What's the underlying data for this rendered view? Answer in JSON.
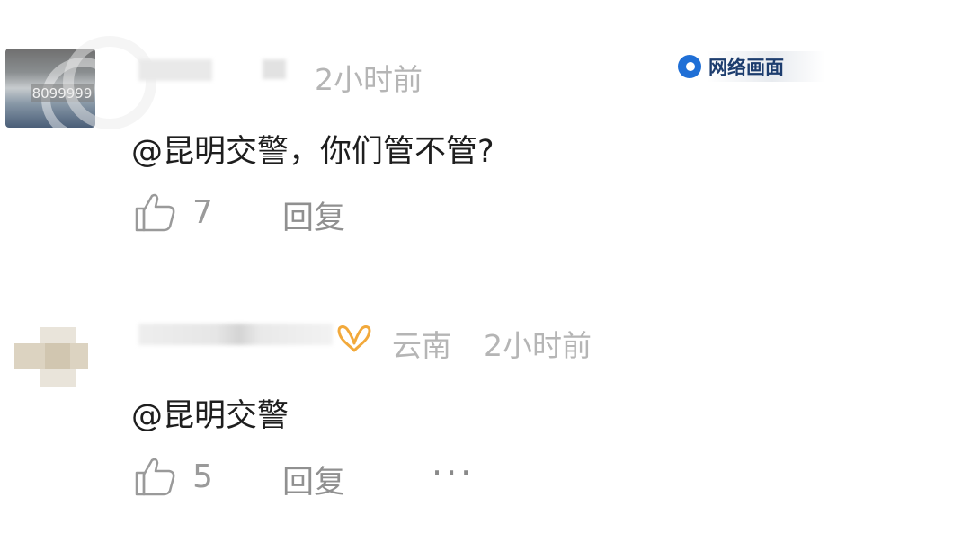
{
  "watermark": {
    "label": "网络画面",
    "brand_color": "#1f6fd6"
  },
  "comments": [
    {
      "avatar_tag": "8099999",
      "time": "2小时前",
      "text": "@昆明交警，你们管不管?",
      "likes": "7",
      "reply_label": "回复"
    },
    {
      "location": "云南",
      "time": "2小时前",
      "text": "@昆明交警",
      "likes": "5",
      "reply_label": "回复",
      "more_label": "···",
      "vip_badge_color": "#f2a93b"
    }
  ]
}
